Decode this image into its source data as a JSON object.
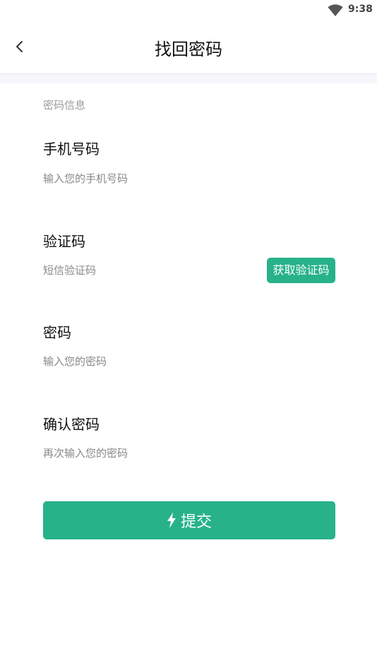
{
  "status_bar": {
    "time": "9:38",
    "wifi_icon": "wifi-icon"
  },
  "header": {
    "back_icon": "chevron-left-icon",
    "title": "找回密码"
  },
  "form": {
    "section_label": "密码信息",
    "phone": {
      "label": "手机号码",
      "placeholder": "输入您的手机号码",
      "value": ""
    },
    "code": {
      "label": "验证码",
      "placeholder": "短信验证码",
      "value": "",
      "get_code_label": "获取验证码"
    },
    "password": {
      "label": "密码",
      "placeholder": "输入您的密码",
      "value": ""
    },
    "confirm_password": {
      "label": "确认密码",
      "placeholder": "再次输入您的密码",
      "value": ""
    },
    "submit": {
      "icon": "lightning-bolt-icon",
      "label": "提交"
    }
  },
  "colors": {
    "accent": "#27b28a",
    "header_border": "#e7e7ee",
    "band": "#f6f6fb",
    "placeholder": "#888888",
    "section_label": "#9a9a9a"
  }
}
